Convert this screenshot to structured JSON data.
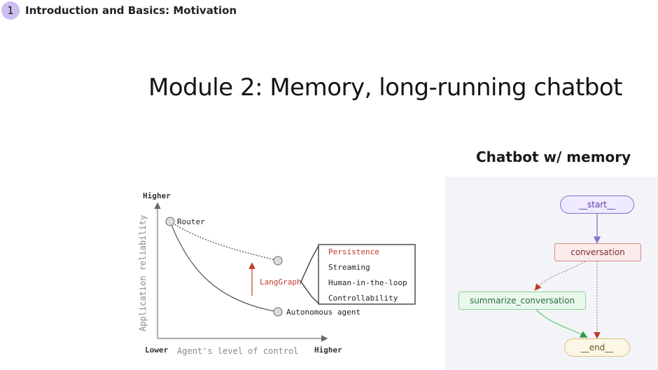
{
  "chapter": {
    "number": "1",
    "title": "Introduction and Basics: Motivation"
  },
  "slide": {
    "title": "Module 2: Memory, long-running chatbot"
  },
  "reliability_diagram": {
    "y_axis_top": "Higher",
    "y_axis_label": "Application reliability",
    "x_axis_left": "Lower",
    "x_axis_label": "Agent's level of control",
    "x_axis_right": "Higher",
    "router_label": "Router",
    "agent_label": "Autonomous agent",
    "langgraph_label": "LangGraph",
    "features": [
      "Persistence",
      "Streaming",
      "Human-in-the-loop",
      "Controllability"
    ],
    "highlight_color": "#c0392b",
    "axis_color": "#555555"
  },
  "chatbot_graph": {
    "title": "Chatbot w/ memory",
    "nodes": {
      "start": "__start__",
      "conversation": "conversation",
      "summarize": "summarize_conversation",
      "end": "__end__"
    }
  }
}
